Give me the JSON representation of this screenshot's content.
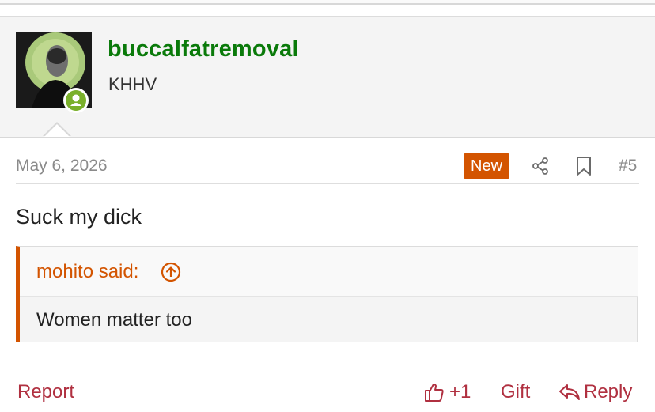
{
  "user": {
    "username": "buccalfatremoval",
    "title": "KHHV",
    "avatar_icon": "user-avatar",
    "status_icon": "online-user-icon",
    "status_color": "#7ab02b",
    "username_color": "#0a7a0a"
  },
  "post": {
    "date": "May 6, 2026",
    "new_badge": "New",
    "number": "#5",
    "body": "Suck my dick",
    "accent_color": "#d35400"
  },
  "quote": {
    "author": "mohito said:",
    "text": "Women matter too",
    "jump_icon": "arrow-up-circle-icon"
  },
  "actions": {
    "report": "Report",
    "like": "+1",
    "gift": "Gift",
    "reply": "Reply",
    "link_color": "#b03040"
  }
}
